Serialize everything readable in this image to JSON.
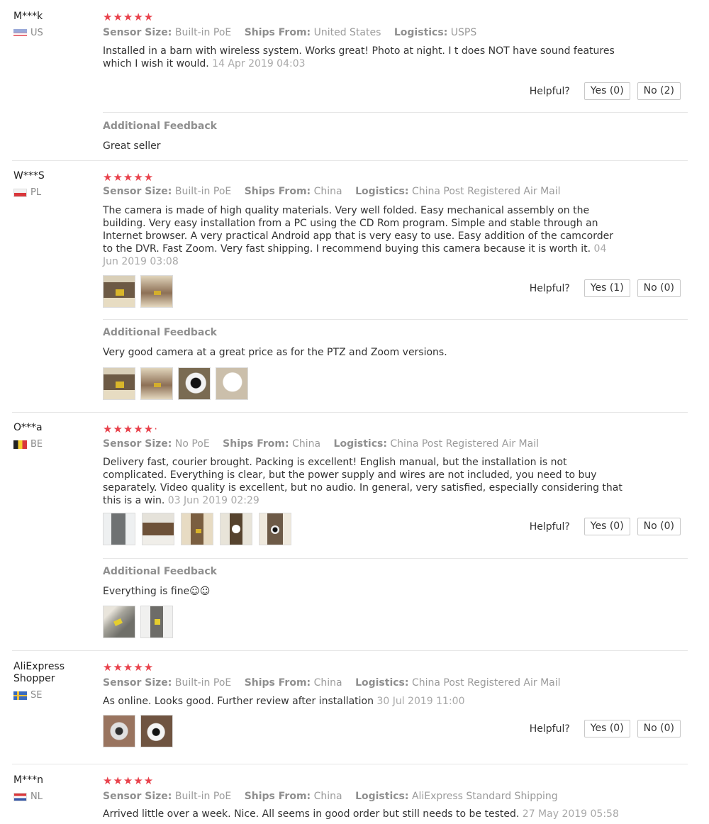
{
  "helpful_label": "Helpful?",
  "additional_feedback_label": "Additional Feedback",
  "meta_labels": {
    "sensor": "Sensor Size:",
    "ships": "Ships From:",
    "logistics": "Logistics:"
  },
  "reviews": [
    {
      "user": "M***k",
      "country": "US",
      "stars": "★★★★★",
      "sensor": "Built-in PoE",
      "ships_from": "United States",
      "logistics": "USPS",
      "text": "Installed in a barn with wireless system. Works great! Photo at night. I t does NOT have sound features which I wish it would.",
      "date": "14 Apr 2019 04:03",
      "yes": "Yes (0)",
      "no": "No (2)",
      "additional": "Great seller"
    },
    {
      "user": "W***S",
      "country": "PL",
      "stars": "★★★★★",
      "sensor": "Built-in PoE",
      "ships_from": "China",
      "logistics": "China Post Registered Air Mail",
      "text": "The camera is made of high quality materials.  Very well folded.  Easy mechanical assembly on the building.  Very easy installation from a PC using the CD Rom program.  Simple and stable through an Internet browser.  A very practical Android app that is very easy to use.  Easy addition of the camcorder to the DVR.  Fast Zoom. Very fast shipping. I recommend buying this camera because it is worth it.",
      "date": "04 Jun 2019 03:08",
      "yes": "Yes (1)",
      "no": "No (0)",
      "additional": "Very good camera at a great price as for the PTZ and Zoom versions."
    },
    {
      "user": "O***a",
      "country": "BE",
      "stars": "★★★★★·",
      "sensor": "No PoE",
      "ships_from": "China",
      "logistics": "China Post Registered Air Mail",
      "text": "Delivery fast, courier brought. Packing is excellent! English manual, but the installation is not complicated. Everything is clear, but the power supply and wires are not included, you need to buy separately. Video quality is excellent, but no audio. In general, very satisfied, especially considering that this is a win.",
      "date": "03 Jun 2019 02:29",
      "yes": "Yes (0)",
      "no": "No (0)",
      "additional": "Everything is fine☺☺"
    },
    {
      "user": "AliExpress Shopper",
      "country": "SE",
      "stars": "★★★★★",
      "sensor": "Built-in PoE",
      "ships_from": "China",
      "logistics": "China Post Registered Air Mail",
      "text": "As online. Looks good. Further review after installation",
      "date": "30 Jul 2019 11:00",
      "yes": "Yes (0)",
      "no": "No (0)"
    },
    {
      "user": "M***n",
      "country": "NL",
      "stars": "★★★★★",
      "sensor": "Built-in PoE",
      "ships_from": "China",
      "logistics": "AliExpress Standard Shipping",
      "text": "Arrived little over a week. Nice. All seems in good order but still needs to be tested.",
      "date": "27 May 2019 05:58"
    }
  ]
}
